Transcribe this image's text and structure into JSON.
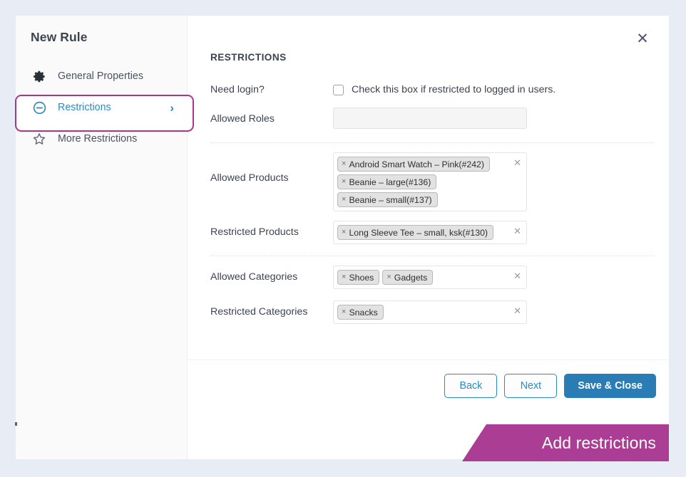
{
  "sidebar": {
    "title": "New Rule",
    "items": [
      {
        "label": "General Properties",
        "icon": "gear-icon",
        "active": false
      },
      {
        "label": "Restrictions",
        "icon": "circle-minus-icon",
        "active": true,
        "chevron": "›"
      },
      {
        "label": "More Restrictions",
        "icon": "star-icon",
        "active": false
      }
    ]
  },
  "content": {
    "panel_title": "RESTRICTIONS",
    "close_icon": "✕",
    "need_login": {
      "label": "Need login?",
      "checkbox_text": "Check this box if restricted to logged in users.",
      "checked": false
    },
    "allowed_roles": {
      "label": "Allowed Roles",
      "value": "",
      "placeholder": ""
    },
    "allowed_products": {
      "label": "Allowed Products",
      "clear_icon": "✕",
      "chips": [
        "Android Smart Watch – Pink(#242)",
        "Beanie – large(#136)",
        "Beanie – small(#137)"
      ]
    },
    "restricted_products": {
      "label": "Restricted Products",
      "clear_icon": "✕",
      "chips": [
        "Long Sleeve Tee – small, ksk(#130)"
      ]
    },
    "allowed_categories": {
      "label": "Allowed Categories",
      "clear_icon": "✕",
      "chips": [
        "Shoes",
        "Gadgets"
      ]
    },
    "restricted_categories": {
      "label": "Restricted Categories",
      "clear_icon": "✕",
      "chips": [
        "Snacks"
      ]
    },
    "chip_remove_icon": "×"
  },
  "footer": {
    "back_label": "Back",
    "next_label": "Next",
    "save_label": "Save & Close"
  },
  "banner": {
    "text": "Add restrictions"
  },
  "colors": {
    "page_background": "#e8ecf4",
    "sidebar_background": "#fafafa",
    "accent_blue": "#2a8bc4",
    "primary_button": "#2a7cb5",
    "highlight_magenta": "#a8368f",
    "banner_magenta": "#ab3d94",
    "text_dark": "#3c4450",
    "chip_background": "#e2e2e2"
  }
}
